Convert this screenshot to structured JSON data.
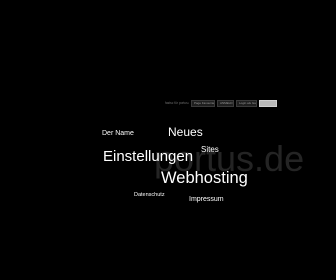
{
  "topbar": {
    "label": "fastsc für portus.de",
    "buttons": [
      {
        "label": "Page Favourite"
      },
      {
        "label": "ANMELD"
      },
      {
        "label": "Login als Gast"
      }
    ],
    "search_placeholder": ""
  },
  "watermark": "portus.de",
  "tag_cloud": {
    "items": [
      {
        "label": "Der Name"
      },
      {
        "label": "Neues"
      },
      {
        "label": "Sites"
      },
      {
        "label": "Einstellungen"
      },
      {
        "label": "Webhosting"
      },
      {
        "label": "Datenschutz"
      },
      {
        "label": "Impressum"
      }
    ]
  },
  "colors": {
    "background": "#000000",
    "link": "#ffffff",
    "watermark": "#242424"
  }
}
